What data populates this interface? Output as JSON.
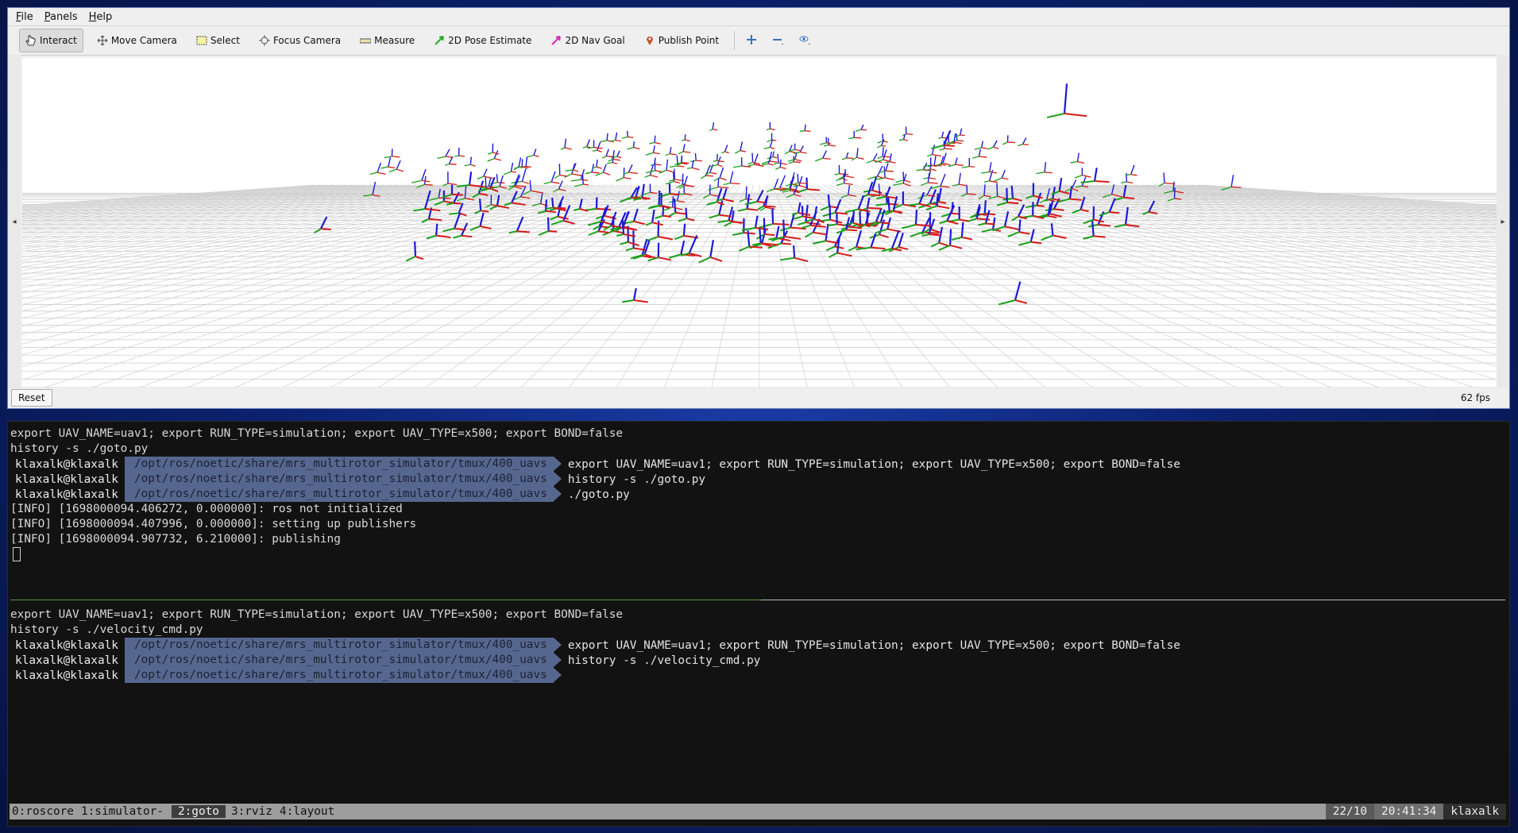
{
  "rviz": {
    "menu": [
      "File",
      "Panels",
      "Help"
    ],
    "tools": [
      {
        "label": "Interact",
        "icon": "cursor-hand-icon"
      },
      {
        "label": "Move Camera",
        "icon": "move-camera-icon"
      },
      {
        "label": "Select",
        "icon": "select-box-icon"
      },
      {
        "label": "Focus Camera",
        "icon": "focus-crosshair-icon"
      },
      {
        "label": "Measure",
        "icon": "ruler-icon"
      },
      {
        "label": "2D Pose Estimate",
        "icon": "green-arrow-icon"
      },
      {
        "label": "2D Nav Goal",
        "icon": "pink-arrow-icon"
      },
      {
        "label": "Publish Point",
        "icon": "map-pin-icon"
      }
    ],
    "reset_label": "Reset",
    "fps": "62 fps"
  },
  "terminal": {
    "pane1": {
      "lines": [
        "export UAV_NAME=uav1; export RUN_TYPE=simulation; export UAV_TYPE=x500; export BOND=false",
        "history -s ./goto.py"
      ],
      "prompts": [
        {
          "user": "klaxalk@klaxalk",
          "path": "/opt/ros/noetic/share/mrs_multirotor_simulator/tmux/400_uavs",
          "cmd": "export UAV_NAME=uav1; export RUN_TYPE=simulation; export UAV_TYPE=x500; export BOND=false"
        },
        {
          "user": "klaxalk@klaxalk",
          "path": "/opt/ros/noetic/share/mrs_multirotor_simulator/tmux/400_uavs",
          "cmd": "history -s ./goto.py"
        },
        {
          "user": "klaxalk@klaxalk",
          "path": "/opt/ros/noetic/share/mrs_multirotor_simulator/tmux/400_uavs",
          "cmd": "./goto.py"
        }
      ],
      "log": [
        "[INFO] [1698000094.406272, 0.000000]: ros not initialized",
        "[INFO] [1698000094.407996, 0.000000]: setting up publishers",
        "[INFO] [1698000094.907732, 6.210000]: publishing"
      ]
    },
    "pane2": {
      "lines": [
        "export UAV_NAME=uav1; export RUN_TYPE=simulation; export UAV_TYPE=x500; export BOND=false",
        "history -s ./velocity_cmd.py"
      ],
      "prompts": [
        {
          "user": "klaxalk@klaxalk",
          "path": "/opt/ros/noetic/share/mrs_multirotor_simulator/tmux/400_uavs",
          "cmd": "export UAV_NAME=uav1; export RUN_TYPE=simulation; export UAV_TYPE=x500; export BOND=false"
        },
        {
          "user": "klaxalk@klaxalk",
          "path": "/opt/ros/noetic/share/mrs_multirotor_simulator/tmux/400_uavs",
          "cmd": "history -s ./velocity_cmd.py"
        },
        {
          "user": "klaxalk@klaxalk",
          "path": "/opt/ros/noetic/share/mrs_multirotor_simulator/tmux/400_uavs",
          "cmd": ""
        }
      ]
    }
  },
  "tmux": {
    "windows": [
      "0:roscore",
      "1:simulator-",
      "2:goto",
      "3:rviz",
      "4:layout"
    ],
    "current": "2:goto",
    "date": "22/10",
    "time": "20:41:34",
    "host": "klaxalk"
  }
}
